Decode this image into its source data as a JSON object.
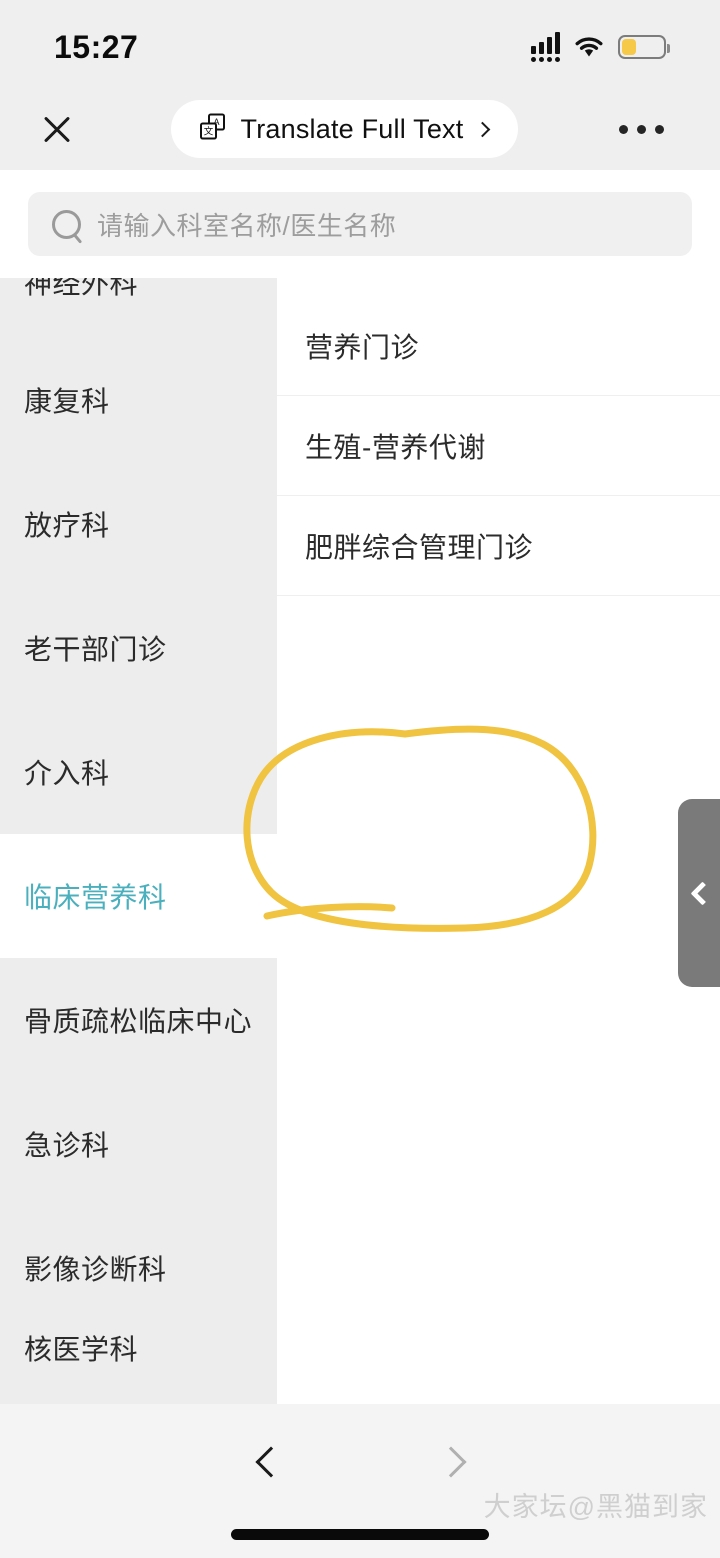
{
  "status_bar": {
    "time": "15:27",
    "signal_icon": "cellular-signal-icon",
    "wifi_icon": "wifi-icon",
    "battery_icon": "battery-icon",
    "battery_color": "#f7c948"
  },
  "navbar": {
    "close_icon": "close-icon",
    "translate_label": "Translate Full Text",
    "translate_icon": "translate-icon",
    "chevron_icon": "chevron-right-icon",
    "more_icon": "more-horizontal-icon"
  },
  "search": {
    "icon": "search-icon",
    "placeholder": "请输入科室名称/医生名称",
    "value": ""
  },
  "sidebar": {
    "items": [
      {
        "label": "神经外科",
        "selected": false,
        "clipped": "top"
      },
      {
        "label": "康复科",
        "selected": false
      },
      {
        "label": "放疗科",
        "selected": false
      },
      {
        "label": "老干部门诊",
        "selected": false
      },
      {
        "label": "介入科",
        "selected": false
      },
      {
        "label": "临床营养科",
        "selected": true
      },
      {
        "label": "骨质疏松临床中心",
        "selected": false
      },
      {
        "label": "急诊科",
        "selected": false
      },
      {
        "label": "影像诊断科",
        "selected": false
      },
      {
        "label": "核医学科",
        "selected": false,
        "clipped": "bottom"
      }
    ],
    "active_color": "#4bb0be"
  },
  "right_panel": {
    "items": [
      {
        "label": "营养门诊",
        "highlighted": false
      },
      {
        "label": "生殖-营养代谢",
        "highlighted": false
      },
      {
        "label": "肥胖综合管理门诊",
        "highlighted": true
      }
    ]
  },
  "edge_tab": {
    "icon": "chevron-left-icon",
    "color": "#7a7a7a"
  },
  "annotation": {
    "type": "hand-drawn-circle",
    "color": "#f0c341",
    "target": "肥胖综合管理门诊"
  },
  "bottom_bar": {
    "back_icon": "chevron-left-icon",
    "forward_icon": "chevron-right-icon",
    "back_enabled": true,
    "forward_enabled": false,
    "home_indicator": "home-indicator",
    "watermark": "大家坛@黑猫到家"
  }
}
